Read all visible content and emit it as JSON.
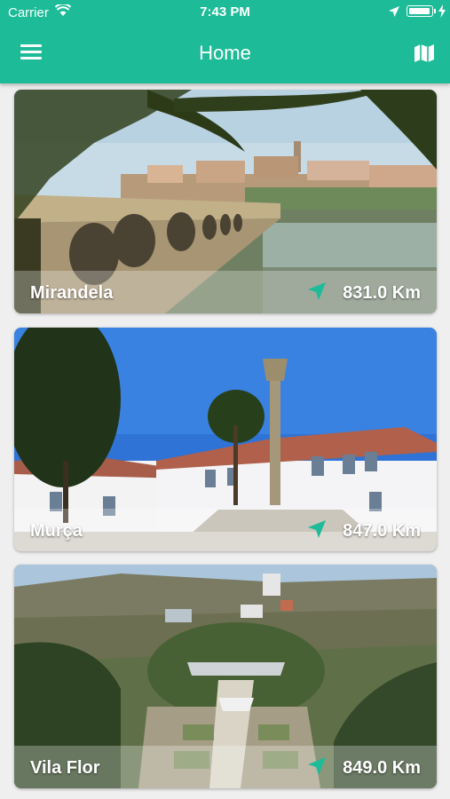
{
  "status_bar": {
    "carrier": "Carrier",
    "time": "7:43 PM"
  },
  "header": {
    "title": "Home",
    "menu_icon": "hamburger-menu-icon",
    "map_icon": "map-icon"
  },
  "colors": {
    "brand": "#1dbb97",
    "nav_icon": "#1dbb97"
  },
  "places": [
    {
      "name": "Mirandela",
      "distance": "831.0 Km"
    },
    {
      "name": "Murça",
      "distance": "847.0 Km"
    },
    {
      "name": "Vila Flor",
      "distance": "849.0 Km"
    }
  ]
}
